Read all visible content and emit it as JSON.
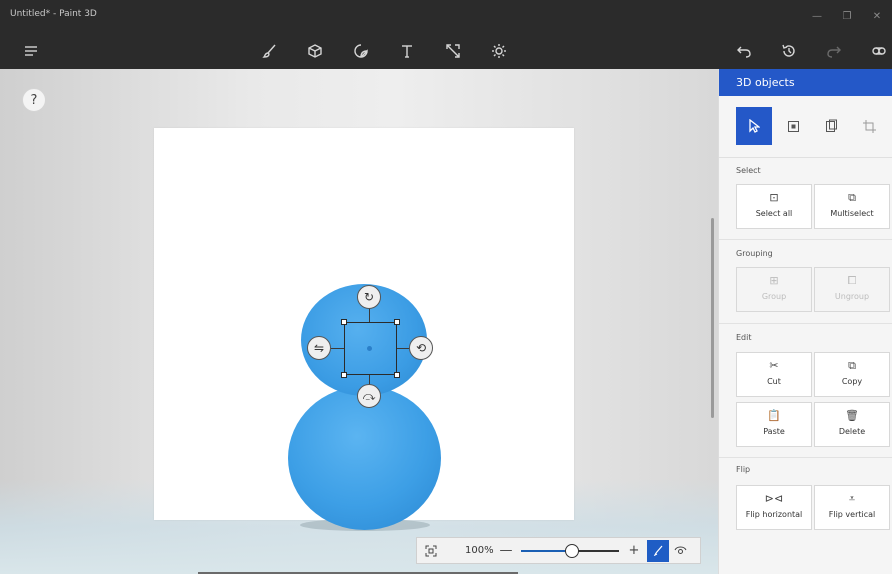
{
  "window": {
    "title": "Untitled* - Paint 3D",
    "controls": [
      "—",
      "❐",
      "✕"
    ]
  },
  "toolbar": {
    "menu_icon": "hamburger-menu-icon",
    "tools": [
      "brush-icon",
      "3d-shapes-icon",
      "stickers-icon",
      "text-icon",
      "canvas-icon",
      "effects-icon"
    ],
    "actions": [
      "undo-icon",
      "history-icon",
      "redo-icon",
      "remix3d-icon"
    ]
  },
  "help": {
    "label": "?"
  },
  "gizmo": {
    "rotate_z": "↻",
    "rotate_y": "⇋",
    "rotate_x": "⟲",
    "depth": "⤼"
  },
  "zoom": {
    "value": "100%",
    "minus": "—",
    "plus": "+",
    "fit_icon": "fit-to-screen-icon",
    "slider_fraction": 0.52
  },
  "panel": {
    "title": "3D objects",
    "modes": [
      "select-mode-icon",
      "select-box-icon",
      "paste-mode-icon",
      "crop-icon"
    ],
    "sections": {
      "select": {
        "title": "Select",
        "items": [
          {
            "label": "Select all",
            "icon": "⊡",
            "enabled": true
          },
          {
            "label": "Multiselect",
            "icon": "⧉",
            "enabled": true
          }
        ]
      },
      "grouping": {
        "title": "Grouping",
        "items": [
          {
            "label": "Group",
            "icon": "⊞",
            "enabled": false
          },
          {
            "label": "Ungroup",
            "icon": "⧠",
            "enabled": false
          }
        ]
      },
      "edit": {
        "title": "Edit",
        "items": [
          {
            "label": "Cut",
            "icon": "✂",
            "enabled": true
          },
          {
            "label": "Copy",
            "icon": "⧉",
            "enabled": true
          },
          {
            "label": "Paste",
            "icon": "📋",
            "enabled": true
          },
          {
            "label": "Delete",
            "icon": "🗑",
            "enabled": true
          }
        ]
      },
      "flip": {
        "title": "Flip",
        "items": [
          {
            "label": "Flip horizontal",
            "icon": "⊳⊲",
            "enabled": true
          },
          {
            "label": "Flip vertical",
            "icon": "⩡",
            "enabled": true
          }
        ]
      }
    }
  },
  "colors": {
    "accent": "#2458c8",
    "object": "#3d9fe6",
    "chrome": "#2b2b2b"
  }
}
